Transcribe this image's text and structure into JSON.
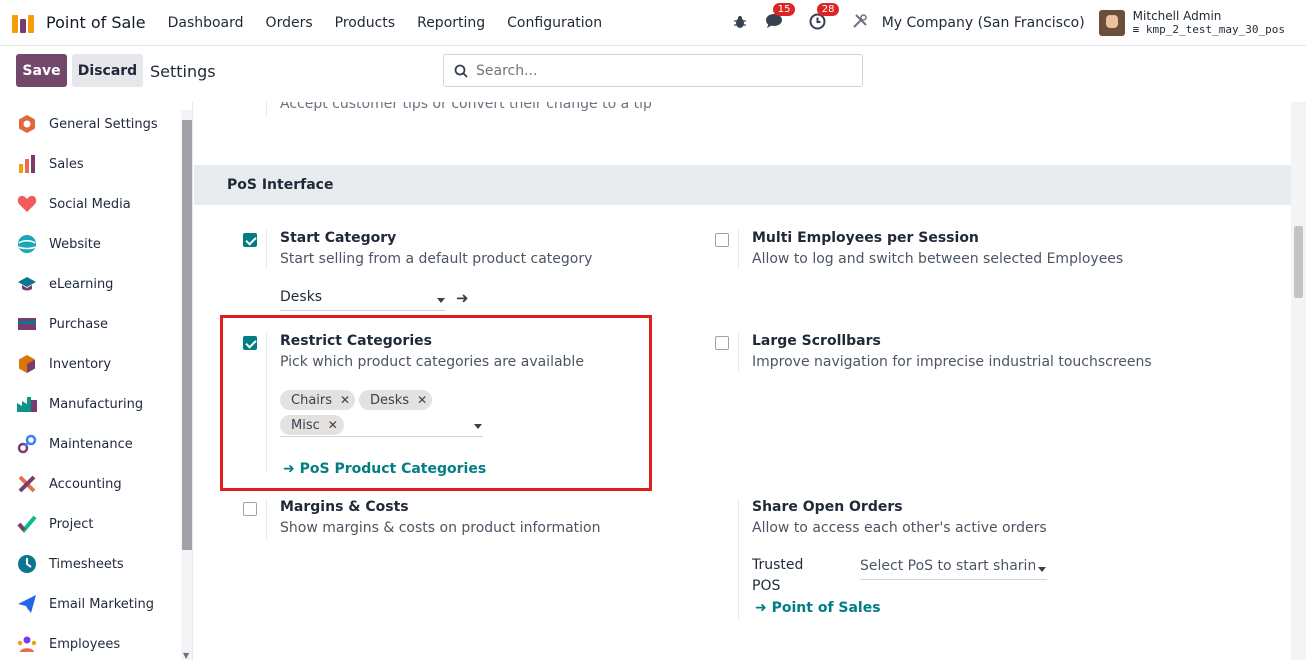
{
  "navbar": {
    "brand": "Point of Sale",
    "menu": [
      "Dashboard",
      "Orders",
      "Products",
      "Reporting",
      "Configuration"
    ],
    "messages_count": "15",
    "activities_count": "28",
    "company": "My Company (San Francisco)",
    "user_name": "Mitchell Admin",
    "db_name": "kmp_2_test_may_30_pos"
  },
  "control_panel": {
    "save_label": "Save",
    "discard_label": "Discard",
    "breadcrumb": "Settings",
    "search_placeholder": "Search..."
  },
  "sidebar": {
    "items": [
      {
        "label": "General Settings",
        "color": "#e0683b"
      },
      {
        "label": "Sales",
        "color": "#f59e0b"
      },
      {
        "label": "Social Media",
        "color": "#f05b5b"
      },
      {
        "label": "Website",
        "color": "#1aa6b7"
      },
      {
        "label": "eLearning",
        "color": "#0e7490"
      },
      {
        "label": "Purchase",
        "color": "#7a3b6e"
      },
      {
        "label": "Inventory",
        "color": "#d97706"
      },
      {
        "label": "Manufacturing",
        "color": "#0d9488"
      },
      {
        "label": "Maintenance",
        "color": "#3b82f6"
      },
      {
        "label": "Accounting",
        "color": "#e76f51"
      },
      {
        "label": "Project",
        "color": "#10b981"
      },
      {
        "label": "Timesheets",
        "color": "#0e7490"
      },
      {
        "label": "Email Marketing",
        "color": "#2563eb"
      },
      {
        "label": "Employees",
        "color": "#7c3aed"
      }
    ]
  },
  "main": {
    "faded_text": "Accept customer tips or convert their change to a tip",
    "section_title": "PoS Interface",
    "start_category": {
      "title": "Start Category",
      "desc": "Start selling from a default product category",
      "checked": true,
      "value": "Desks"
    },
    "multi_employees": {
      "title": "Multi Employees per Session",
      "desc": "Allow to log and switch between selected Employees",
      "checked": false
    },
    "restrict_categories": {
      "title": "Restrict Categories",
      "desc": "Pick which product categories are available",
      "checked": true,
      "tags": [
        "Chairs",
        "Desks",
        "Misc"
      ],
      "link": "PoS Product Categories"
    },
    "large_scrollbars": {
      "title": "Large Scrollbars",
      "desc": "Improve navigation for imprecise industrial touchscreens",
      "checked": false
    },
    "margins_costs": {
      "title": "Margins & Costs",
      "desc": "Show margins & costs on product information",
      "checked": false
    },
    "share_orders": {
      "title": "Share Open Orders",
      "desc": "Allow to access each other's active orders",
      "trusted_label_1": "Trusted",
      "trusted_label_2": "POS",
      "select_placeholder": "Select PoS to start sharing o",
      "link": "Point of Sales"
    }
  }
}
